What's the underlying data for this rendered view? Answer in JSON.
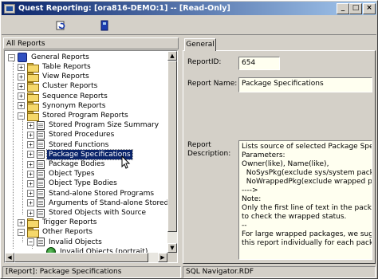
{
  "window": {
    "title": "Quest Reporting: [ora816-DEMO:1] -- [Read-Only]",
    "controls": {
      "minimize": "_",
      "maximize": "□",
      "close": "×"
    }
  },
  "toolbar": {
    "buttons": [
      {
        "name": "refresh-report-button",
        "icon": "refresh-icon"
      },
      {
        "name": "print-button",
        "icon": "printer-icon"
      }
    ]
  },
  "left_pane": {
    "header": "All Reports",
    "tree": {
      "root": "General Reports",
      "items": [
        {
          "label": "Table Reports",
          "expander": "+"
        },
        {
          "label": "View Reports",
          "expander": "+"
        },
        {
          "label": "Cluster Reports",
          "expander": "+"
        },
        {
          "label": "Sequence Reports",
          "expander": "+"
        },
        {
          "label": "Synonym Reports",
          "expander": "+"
        },
        {
          "label": "Stored Program Reports",
          "expander": "−"
        },
        {
          "label": "Stored Program Size Summary",
          "expander": "+"
        },
        {
          "label": "Stored Procedures",
          "expander": "+"
        },
        {
          "label": "Stored Functions",
          "expander": "+"
        },
        {
          "label": "Package Specifications",
          "expander": "+"
        },
        {
          "label": "Package Bodies",
          "expander": "+"
        },
        {
          "label": "Object Types",
          "expander": "+"
        },
        {
          "label": "Object Type Bodies",
          "expander": "+"
        },
        {
          "label": "Stand-alone Stored Programs",
          "expander": "+"
        },
        {
          "label": "Arguments of Stand-alone Stored Program",
          "expander": "+"
        },
        {
          "label": "Stored Objects with Source",
          "expander": "+"
        },
        {
          "label": "Trigger Reports",
          "expander": "+"
        },
        {
          "label": "Other Reports",
          "expander": "−"
        },
        {
          "label": "Invalid Objects",
          "expander": "−"
        },
        {
          "label": "Invalid Objects (portrait)",
          "expander": ""
        }
      ]
    }
  },
  "right_pane": {
    "tab": "General",
    "report_id_label": "ReportID:",
    "report_id_value": "654",
    "report_name_label": "Report Name:",
    "report_name_value": "Package Specifications",
    "report_description_label": "Report\nDescription:",
    "report_description_value": "Lists source of selected Package Speci\nParameters:\nOwner(like), Name(like),\n  NoSysPkg(exclude sys/system packa\n  NoWrappedPkg(exclude wrapped pa\n---->\nNote:\nOnly the first line of text in the package\nto check the wrapped status.\n--\nFor large wrapped packages, we sugg\nthis report individually for each package"
  },
  "status_bar": {
    "report": "[Report]: Package Specifications",
    "file": "SQL Navigator.RDF"
  },
  "colors": {
    "title_gradient_start": "#0a246a",
    "title_gradient_end": "#a6caf0",
    "selection": "#0a246a",
    "field_background": "#fffff0"
  }
}
